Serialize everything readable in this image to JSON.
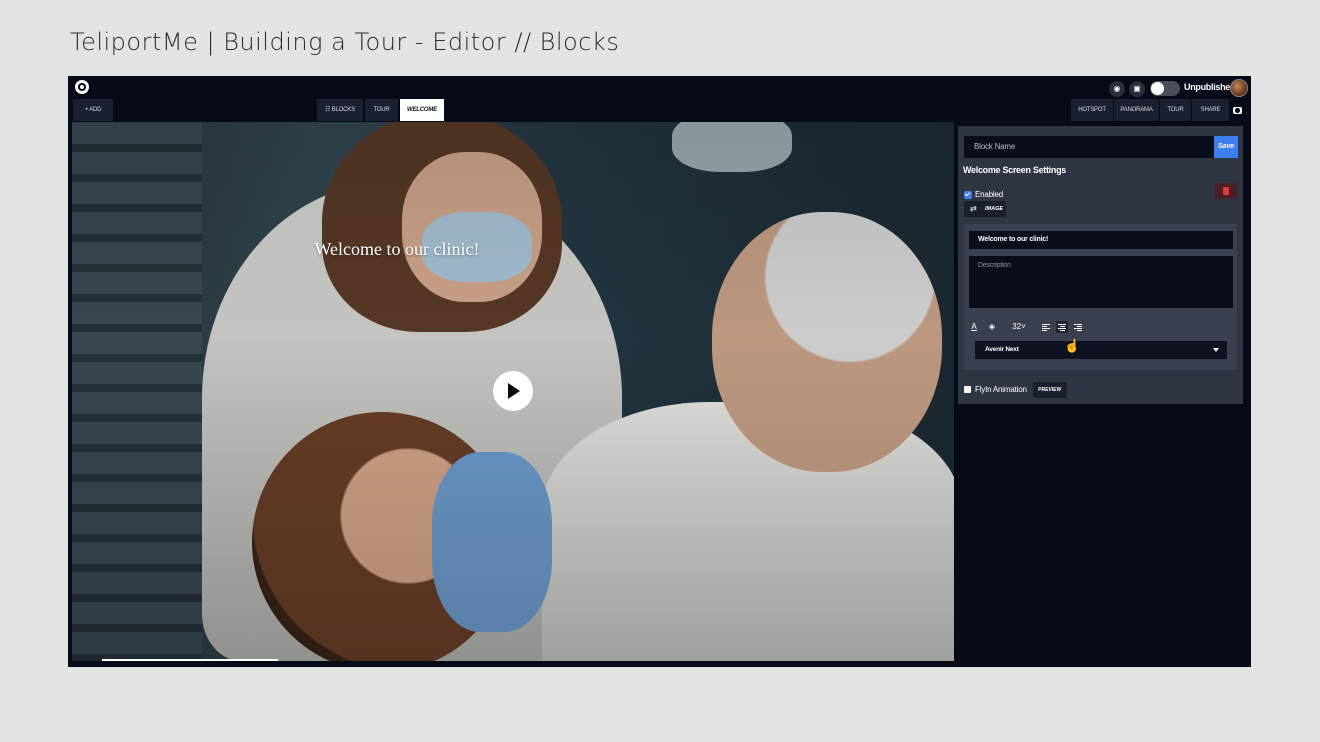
{
  "slide": {
    "title": "TeliportMe | Building a Tour - Editor // Blocks"
  },
  "topbar": {
    "publish_status": "Unpublished",
    "view_icon": "eye-icon",
    "save_icon": "floppy-icon"
  },
  "toolbar": {
    "add_label": "+ ADD",
    "center_tabs": [
      {
        "label": "☷ BLOCKS"
      },
      {
        "label": "TOUR"
      },
      {
        "label": "WELCOME"
      }
    ],
    "right_tabs": [
      {
        "label": "HOTSPOT"
      },
      {
        "label": "PANORAMA"
      },
      {
        "label": "TOUR"
      },
      {
        "label": "SHARE"
      }
    ]
  },
  "viewport": {
    "welcome_text": "Welcome to our clinic!"
  },
  "panel": {
    "block_name_placeholder": "Block Name",
    "save_label": "Save",
    "settings_title": "Welcome Screen Settings",
    "enabled_label": "Enabled",
    "enabled_checked": true,
    "image_label": "IMAGE",
    "title_value": "Welcome to our clinic!",
    "description_placeholder": "Description",
    "font_size": "32",
    "font_family": "Avenir Next",
    "flyin_label": "FlyIn Animation",
    "flyin_checked": false,
    "preview_label": "PREVIEW"
  },
  "colors": {
    "app_bg": "#070b18",
    "panel_bg": "#2f3543",
    "accent": "#3d7ff0",
    "danger": "#e5383b"
  }
}
